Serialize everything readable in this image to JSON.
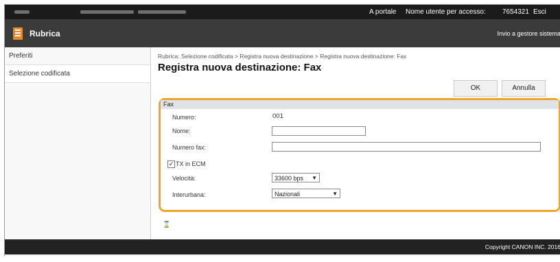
{
  "topbar": {
    "portal_link": "A portale",
    "user_label": "Nome utente per accesso:",
    "user_value": "7654321",
    "logout": "Esci"
  },
  "app": {
    "title": "Rubrica",
    "send_manager": "Invio a gestore sistema"
  },
  "sidebar": {
    "items": [
      {
        "label": "Preferiti"
      },
      {
        "label": "Selezione codificata"
      }
    ]
  },
  "main": {
    "breadcrumb": "Rubrica: Selezione codificata > Registra nuova destinazione > Registra nuova destinazione: Fax",
    "title": "Registra nuova destinazione: Fax",
    "ok_label": "OK",
    "cancel_label": "Annulla"
  },
  "fax": {
    "section": "Fax",
    "number_label": "Numero:",
    "number_value": "001",
    "name_label": "Nome:",
    "name_value": "",
    "faxnum_label": "Numero fax:",
    "faxnum_value": "",
    "ecm_label": "TX in ECM",
    "ecm_checked": true,
    "speed_label": "Velocità:",
    "speed_value": "33600 bps",
    "longdist_label": "Interurbana:",
    "longdist_value": "Nazionali"
  },
  "footer": {
    "copyright": "Copyright CANON INC. 2016"
  },
  "colors": {
    "accent": "#f0a427",
    "brand": "#e8892c",
    "topbar": "#1b1b1b"
  }
}
